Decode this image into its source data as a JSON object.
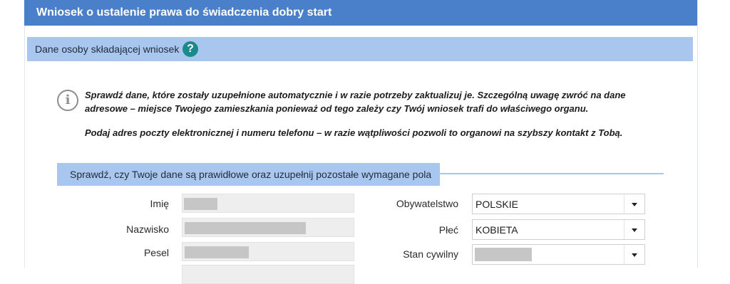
{
  "header": {
    "title": "Wniosek o ustalenie prawa do świadczenia dobry start"
  },
  "section": {
    "title": "Dane osoby składającej wniosek",
    "help_icon": "?"
  },
  "info": {
    "icon": "i",
    "paragraph1": "Sprawdź dane, które zostały uzupełnione automatycznie i w razie potrzeby zaktualizuj je. Szczególną uwagę zwróć na dane adresowe – miejsce Twojego zamieszkania ponieważ od tego zależy czy Twój wniosek trafi do właściwego organu.",
    "paragraph2": "Podaj adres poczty elektronicznej i numeru telefonu – w razie wątpliwości pozwoli to organowi na szybszy kontakt z Tobą."
  },
  "subsection": {
    "title": "Sprawdź, czy Twoje dane są prawidłowe oraz uzupełnij pozostałe wymagane pola"
  },
  "form": {
    "left": [
      {
        "label": "Imię"
      },
      {
        "label": "Nazwisko"
      },
      {
        "label": "Pesel"
      }
    ],
    "right": [
      {
        "label": "Obywatelstwo",
        "value": "POLSKIE"
      },
      {
        "label": "Płeć",
        "value": "KOBIETA"
      },
      {
        "label": "Stan cywilny",
        "value": ""
      }
    ]
  }
}
